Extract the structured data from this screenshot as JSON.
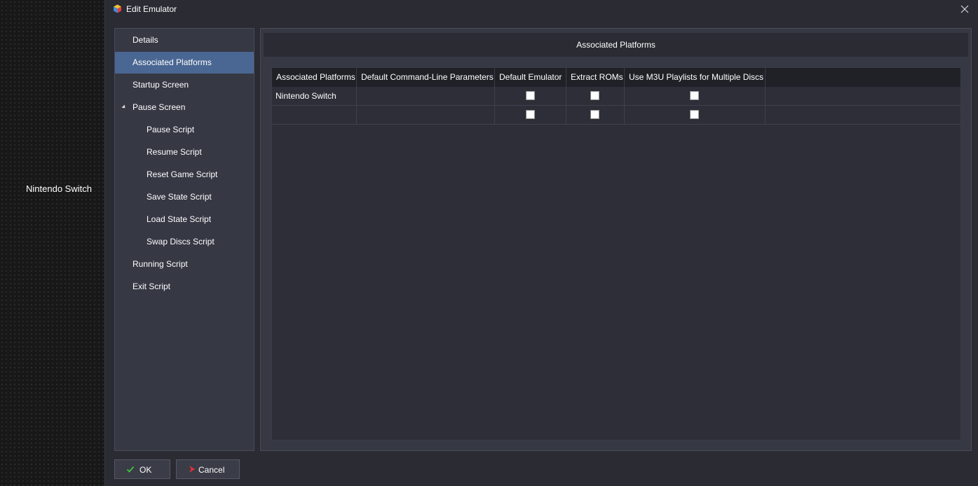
{
  "background_app": {
    "platform_label": "Nintendo Switch"
  },
  "window": {
    "title": "Edit Emulator",
    "icon": "launchbox-cube-icon",
    "close_icon": "close-icon"
  },
  "nav": {
    "selected_index": 1,
    "items": [
      {
        "label": "Details",
        "level": 0
      },
      {
        "label": "Associated Platforms",
        "level": 0
      },
      {
        "label": "Startup Screen",
        "level": 0
      },
      {
        "label": "Pause Screen",
        "level": 0,
        "expanded": true
      },
      {
        "label": "Pause Script",
        "level": 1
      },
      {
        "label": "Resume Script",
        "level": 1
      },
      {
        "label": "Reset Game Script",
        "level": 1
      },
      {
        "label": "Save State Script",
        "level": 1
      },
      {
        "label": "Load State Script",
        "level": 1
      },
      {
        "label": "Swap Discs Script",
        "level": 1
      },
      {
        "label": "Running Script",
        "level": 0
      },
      {
        "label": "Exit Script",
        "level": 0
      }
    ]
  },
  "content": {
    "section_title": "Associated Platforms",
    "grid": {
      "columns": [
        "Associated Platforms",
        "Default Command-Line Parameters",
        "Default Emulator",
        "Extract ROMs",
        "Use M3U Playlists for Multiple Discs"
      ],
      "rows": [
        {
          "platform": "Nintendo Switch",
          "params": "",
          "default_emulator": false,
          "extract_roms": false,
          "use_m3u": false
        },
        {
          "platform": "",
          "params": "",
          "default_emulator": false,
          "extract_roms": false,
          "use_m3u": false
        }
      ]
    }
  },
  "buttons": {
    "ok_label": "OK",
    "cancel_label": "Cancel",
    "ok_icon": "checkmark-icon",
    "cancel_icon": "cancel-arrow-icon"
  },
  "colors": {
    "selected_nav": "#4a6793",
    "panel": "#363844",
    "window": "#2a2b33",
    "ok_icon": "#3ec43e",
    "cancel_icon": "#e0303a"
  }
}
